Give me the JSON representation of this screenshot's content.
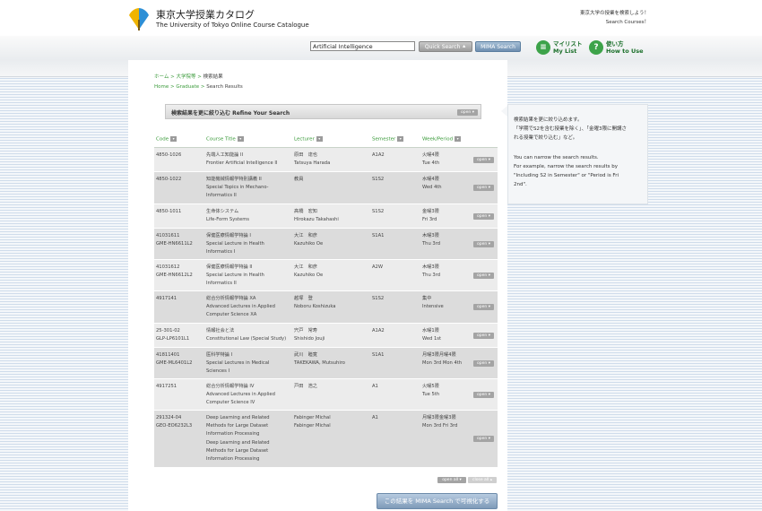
{
  "header": {
    "title_ja": "東京大学授業カタログ",
    "title_en": "The University of Tokyo Online Course Catalogue",
    "tagline_ja": "東京大学の授業を検索しよう！",
    "tagline_en": "Search Courses！"
  },
  "search": {
    "value": "Artificial Intelligence",
    "quick_label": "Quick Search ⯅",
    "mima_label": "MIMA Search"
  },
  "nav": {
    "mylist_ja": "マイリスト",
    "mylist_en": "My List",
    "howto_ja": "使い方",
    "howto_en": "How to Use"
  },
  "breadcrumb": {
    "ja_home": "ホーム",
    "ja_grad": "大学院等",
    "ja_cur": "検索結果",
    "en_home": "Home",
    "en_grad": "Graduate",
    "en_cur": "Search Results"
  },
  "refine": {
    "title": "検索結果を更に絞り込む Refine Your Search",
    "open_label": "open ▾"
  },
  "table": {
    "headers": {
      "code": "Code",
      "title": "Course Title",
      "lecturer": "Lecturer",
      "semester": "Semester",
      "week": "Week/Period"
    },
    "open_label": "open ▾",
    "rows": [
      {
        "code1": "4850-1026",
        "code2": "",
        "t1": "先端人工知能論 II",
        "t2": "Frontier Artificial Intelligence II",
        "t3": "",
        "t4": "",
        "t5": "",
        "l1": "原田　達也",
        "l2": "Tatsuya Harada",
        "sem": "A1A2",
        "w1": "火曜4限",
        "w2": "Tue 4th"
      },
      {
        "code1": "4850-1022",
        "code2": "",
        "t1": "知能機械情報学特別講義 II",
        "t2": "Special Topics in Mechano-",
        "t3": "Informatics II",
        "t4": "",
        "t5": "",
        "l1": "教員",
        "l2": "",
        "sem": "S1S2",
        "w1": "水曜4限",
        "w2": "Wed 4th"
      },
      {
        "code1": "4850-1011",
        "code2": "",
        "t1": "生命体システム",
        "t2": "Life-Form Systems",
        "t3": "",
        "t4": "",
        "t5": "",
        "l1": "高橋　宏知",
        "l2": "Hirokazu Takahashi",
        "sem": "S1S2",
        "w1": "金曜3限",
        "w2": "Fri 3rd"
      },
      {
        "code1": "41031611",
        "code2": "GME-HN6611L2",
        "t1": "保健医療情報学特論 I",
        "t2": "Special Lecture in Health",
        "t3": "Informatics I",
        "t4": "",
        "t5": "",
        "l1": "大江　和彦",
        "l2": "Kazuhiko Oe",
        "sem": "S1A1",
        "w1": "木曜3限",
        "w2": "Thu 3rd"
      },
      {
        "code1": "41031612",
        "code2": "GME-HN6612L2",
        "t1": "保健医療情報学特論 II",
        "t2": "Special Lecture in Health",
        "t3": "Informatics II",
        "t4": "",
        "t5": "",
        "l1": "大江　和彦",
        "l2": "Kazuhiko Oe",
        "sem": "A2W",
        "w1": "木曜3限",
        "w2": "Thu 3rd"
      },
      {
        "code1": "4917141",
        "code2": "",
        "t1": "総合分析情報学特論 XA",
        "t2": "Advanced Lectures in Applied",
        "t3": "Computer Science XA",
        "t4": "",
        "t5": "",
        "l1": "越塚　登",
        "l2": "Noboru Koshizuka",
        "sem": "S1S2",
        "w1": "集中",
        "w2": "Intensive"
      },
      {
        "code1": "25-301-02",
        "code2": "GLP-LP6101L1",
        "t1": "情報社会と法",
        "t2": "Constitutional Law (Special Study)",
        "t3": "",
        "t4": "",
        "t5": "",
        "l1": "宍戸　常寿",
        "l2": "Shishido Jouji",
        "sem": "A1A2",
        "w1": "水曜1限",
        "w2": "Wed 1st"
      },
      {
        "code1": "41811401",
        "code2": "GME-ML6401L2",
        "t1": "医科学特論 I",
        "t2": "Special Lectures in Medical",
        "t3": "Sciences I",
        "t4": "",
        "t5": "",
        "l1": "武川　睦寛",
        "l2": "TAKEKAWA, Mutsuhiro",
        "sem": "S1A1",
        "w1": "月曜3限月曜4限",
        "w2": "Mon 3rd Mon 4th"
      },
      {
        "code1": "4917251",
        "code2": "",
        "t1": "総合分析情報学特論 IV",
        "t2": "Advanced Lectures in Applied",
        "t3": "Computer Science IV",
        "t4": "",
        "t5": "",
        "l1": "戸田　浩之",
        "l2": "",
        "sem": "A1",
        "w1": "火曜5限",
        "w2": "Tue 5th"
      },
      {
        "code1": "291324-04",
        "code2": "GEO-EO6232L3",
        "t1": "Deep Learning and Related",
        "t2": "Methods for Large Dataset",
        "t3": "Information Processing",
        "t4": "Deep Learning and Related",
        "t5": "Methods for Large Dataset",
        "t6": "Information Processing",
        "l1": "Fabinger Michal",
        "l2": "Fabinger Michal",
        "sem": "A1",
        "w1": "月曜3限金曜3限",
        "w2": "Mon 3rd Fri 3rd"
      }
    ]
  },
  "footer": {
    "open_all": "open all ▾",
    "close_all": "close all ▴",
    "mima_visualize": "この結果を MIMA Search で可視化する"
  },
  "sidebox": {
    "ja1": "検索結果を更に絞り込めます。",
    "ja2": "「学期でS2を含む授業を除く」、「金曜3限に開講さ",
    "ja3": "れる授業で絞り込む」など。",
    "en1": "You can narrow the search results.",
    "en2": "For example, narrow the search results by",
    "en3": "\"Including S2 in Semester\" or \"Period is Fri",
    "en4": "2nd\"."
  }
}
